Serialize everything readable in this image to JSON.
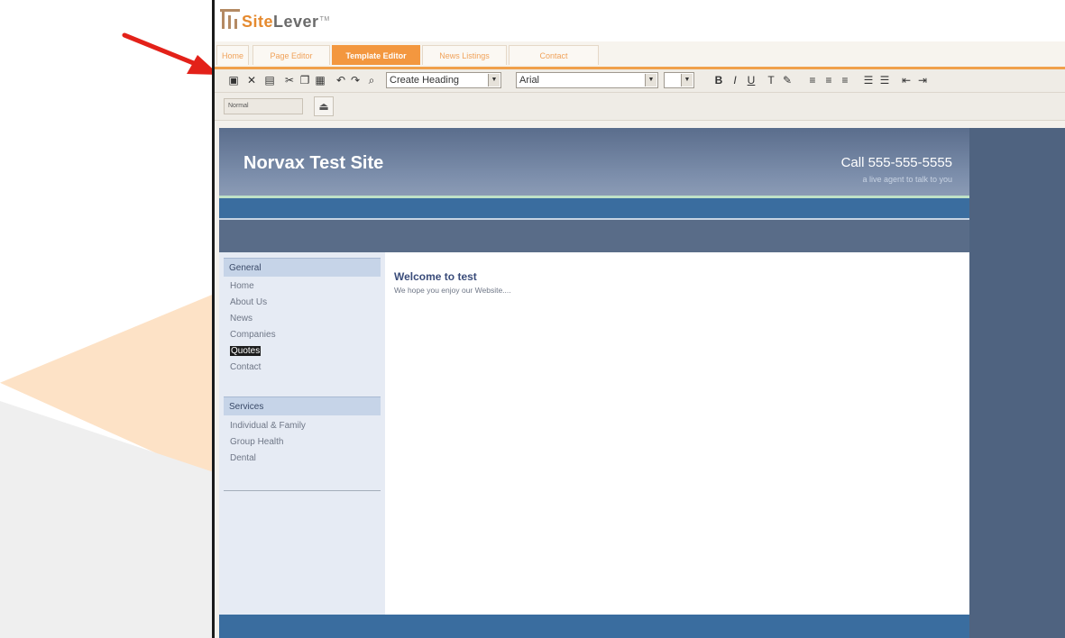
{
  "app": {
    "logo_part1": "Site",
    "logo_part2": "Lever",
    "logo_tm": "TM"
  },
  "tabs": [
    {
      "label": "Home",
      "active": false
    },
    {
      "label": "Page Editor",
      "active": false
    },
    {
      "label": "Template Editor",
      "active": true
    },
    {
      "label": "News Listings",
      "active": false
    },
    {
      "label": "Contact",
      "active": false
    }
  ],
  "toolbar": {
    "style_select": "Create Heading",
    "font_select": "Arial",
    "size_select": "",
    "format_select": "Normal"
  },
  "site": {
    "title": "Norvax Test Site",
    "phone": "Call 555-555-5555",
    "tagline": "a live agent to talk to you",
    "general_heading": "General",
    "general_links": [
      "Home",
      "About Us",
      "News",
      "Companies",
      "Quotes",
      "Contact"
    ],
    "services_heading": "Services",
    "services_links": [
      "Individual & Family",
      "Group Health",
      "Dental"
    ],
    "welcome_title": "Welcome to test",
    "welcome_text": "We hope you enjoy our Website...."
  },
  "colors": {
    "accent_orange": "#f3973f",
    "site_blue": "#3a6d9f",
    "site_slate": "#4f6380",
    "annotation_arrow": "#e32119"
  }
}
